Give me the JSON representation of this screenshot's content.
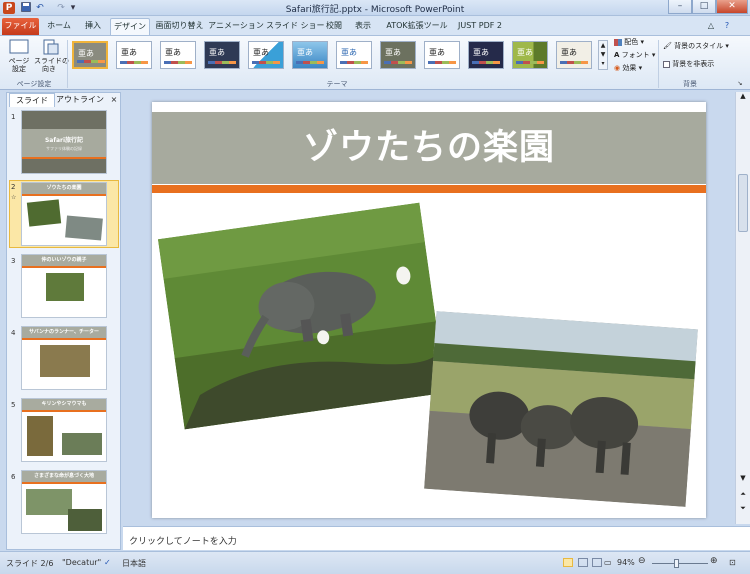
{
  "window": {
    "title": "Safari旅行記.pptx - Microsoft PowerPoint",
    "minimize": "–",
    "maximize": "□",
    "close": "✕",
    "app_icon": "P"
  },
  "quick_access": {
    "save_icon": "save-icon",
    "undo_icon": "undo-icon",
    "redo_icon": "redo-icon",
    "customize_icon": "customize-icon"
  },
  "tabs": [
    "ファイル",
    "ホーム",
    "挿入",
    "デザイン",
    "画面切り替え",
    "アニメーション",
    "スライド ショー",
    "校閲",
    "表示",
    "ATOK拡張ツール",
    "JUST PDF 2"
  ],
  "active_tab": "デザイン",
  "ribbon": {
    "page_setup": {
      "label": "ページ\n設定",
      "group": "ページ設定"
    },
    "orientation": {
      "label": "スライドの\n向き"
    },
    "themes_group": "テーマ",
    "theme_sample": "亜あ",
    "colors": "配色",
    "fonts": "フォント",
    "effects": "効果",
    "bg_styles": "背景のスタイル",
    "hide_bg": "背景を非表示",
    "bg_group": "背景"
  },
  "pane": {
    "tab_slides": "スライド",
    "tab_outline": "アウトライン",
    "close": "×"
  },
  "slides": [
    {
      "num": "1",
      "title": "Safari旅行記",
      "subtitle": "サファリ体験の記録"
    },
    {
      "num": "2",
      "title": "ゾウたちの楽園"
    },
    {
      "num": "3",
      "title": "仲のいいゾウの親子"
    },
    {
      "num": "4",
      "title": "サバンナのランナー、チーター"
    },
    {
      "num": "5",
      "title": "キリンやシマウマも"
    },
    {
      "num": "6",
      "title": "さまざまな命が息づく大地"
    }
  ],
  "slide2_marker": "☆",
  "current_slide": {
    "title": "ゾウたちの楽園"
  },
  "notes_placeholder": "クリックしてノートを入力",
  "status": {
    "slide_indicator": "スライド 2/6",
    "theme": "\"Decatur\"",
    "language": "日本語",
    "zoom": "94%"
  }
}
